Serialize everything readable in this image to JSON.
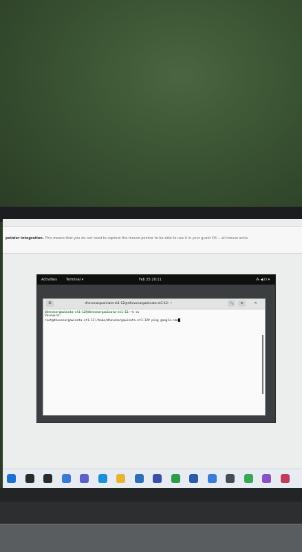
{
  "virtualbox": {
    "notice_bold": "pointer integration.",
    "notice_text": " This means that you do not need to capture the mouse pointer to be able to use it in your guest OS -- all mouse actio"
  },
  "gnome": {
    "activities": "Activities",
    "app_menu": "Terminal ▾",
    "clock": "Feb 25  20:11",
    "status_icons": "⁂ ◀ ⏻ ▾"
  },
  "terminal": {
    "title": "dhevonargawinata-xt1-12@dhevonargawinata-xt1-12: ~",
    "tab_icon": "⊞",
    "search_glyph": "🔍",
    "menu_glyph": "≡",
    "close_glyph": "×",
    "line1_prompt": "dhevonargawinata-xt1-12@dhevonargawinata-xt1-12",
    "line1_rest": ":~$ su",
    "line2": "Password:",
    "line3": "root@dhevonargawinata-xt1-12:/home/dhevonargawinata-xt1-12# ping google.com"
  },
  "taskbar": {
    "icon_names": [
      "windows-start-icon",
      "search-icon",
      "taskview-icon",
      "widgets-icon",
      "teams-icon",
      "edge-icon",
      "file-explorer-icon",
      "store-icon",
      "virtualbox-icon",
      "app-icon-1",
      "word-icon",
      "photos-icon",
      "app-icon-2",
      "chrome-icon",
      "app-icon-3",
      "app-icon-4"
    ],
    "colors": [
      "#1f6fd1",
      "#2b2b2b",
      "#2b2b2b",
      "#3a7bd5",
      "#5b5fc7",
      "#1b8fd8",
      "#e8b533",
      "#2f6fb5",
      "#3c4fa8",
      "#2d9b4a",
      "#2b5aa8",
      "#3a7bd5",
      "#444c55",
      "#3aa757",
      "#8d4fc6",
      "#c33a5a"
    ]
  },
  "colors": {
    "wall": "#3a5332",
    "screen_bg": "#eceeed",
    "terminal_prompt": "#2e8b3a"
  }
}
